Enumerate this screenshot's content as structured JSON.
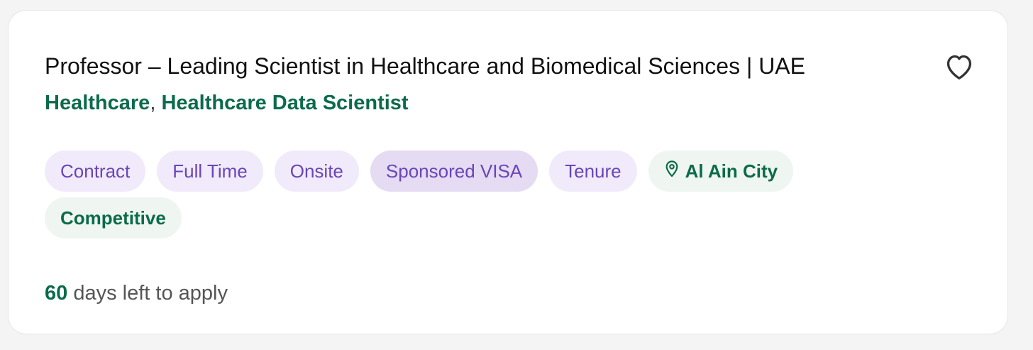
{
  "job": {
    "title": "Professor – Leading Scientist in Healthcare and Biomedical Sciences | UAE",
    "categories": [
      "Healthcare",
      "Healthcare Data Scientist"
    ],
    "category_separator": ",",
    "favorite_icon": "heart-outline-icon",
    "tags": {
      "contract": "Contract",
      "full_time": "Full Time",
      "onsite": "Onsite",
      "sponsored_visa": "Sponsored VISA",
      "tenure": "Tenure",
      "location": "Al Ain City",
      "location_icon": "map-pin-icon",
      "salary": "Competitive"
    },
    "deadline": {
      "days": "60",
      "suffix": "days left to apply"
    }
  },
  "colors": {
    "accent_green": "#0b6b4a",
    "tag_purple_text": "#6a45b8",
    "tag_purple_bg": "#f1eafb",
    "tag_green_bg": "#eff5f1"
  }
}
